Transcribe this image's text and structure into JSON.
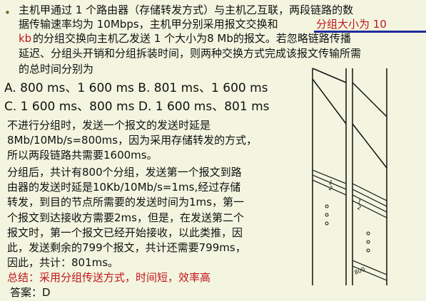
{
  "question": {
    "bullet": "•",
    "lines": [
      "主机甲通过 1 个路由器（存储转发方式）与主机乙互联，两段链路的数",
      "据传输速率均为 10Mbps，主机甲分别采用报文交换和",
      "分组大小为 10",
      "kb",
      " 的分组交换向主机乙发送 1 个大小为8 Mb的报文。若忽略链路传播",
      "延迟、分组头开销和分组拆装时间，则两种交换方式完成该报文传输所需",
      "的总时间分别为"
    ]
  },
  "options": {
    "row1": "A. 800 ms、1 600 ms   B. 801 ms、1 600 ms",
    "row2": "C. 1 600 ms、800 ms   D. 1 600 ms、801 ms"
  },
  "explanation": {
    "lines": [
      "不进行分组时，发送一个报文的发送时延是",
      "8Mb/10Mb/s=800ms，因为采用存储转发的方式，",
      "所以两段链路共需要1600ms。",
      "分组后，共计有800个分组，发送第一个报文到路",
      "由器的发送时延是10Kb/10Mb/s=1ms,经过存储",
      "转发，到目的节点所需要的发送时间为1ms，第一",
      "个报文到达接收方需要2ms，但是，在发送第二个",
      "报文时，第一个报文已经开始接收，以此类推，因",
      "此，发送剩余的799个报文，共计还需要799ms，",
      "因此，共计：801ms。"
    ],
    "summary": "总结：采用分组传送方式，时间短，效率高",
    "answer": "答案：D"
  },
  "diagram2": {
    "labels": [
      "1",
      "2",
      "1",
      "2",
      "800"
    ]
  }
}
